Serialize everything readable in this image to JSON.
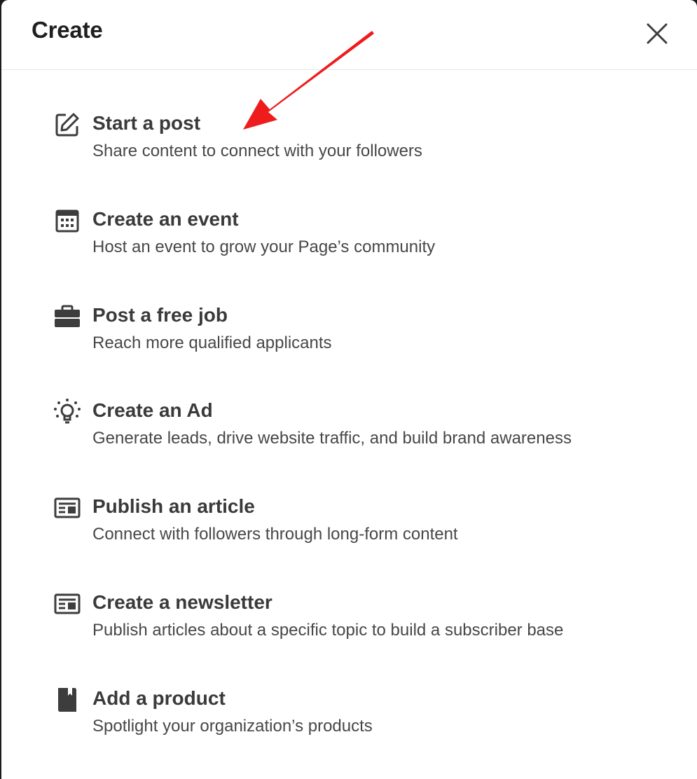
{
  "modal": {
    "title": "Create",
    "close_icon": "close-icon"
  },
  "items": [
    {
      "icon": "pencil-square-icon",
      "title": "Start a post",
      "description": "Share content to connect with your followers"
    },
    {
      "icon": "calendar-icon",
      "title": "Create an event",
      "description": "Host an event to grow your Page’s community"
    },
    {
      "icon": "briefcase-icon",
      "title": "Post a free job",
      "description": "Reach more qualified applicants"
    },
    {
      "icon": "lightbulb-icon",
      "title": "Create an Ad",
      "description": "Generate leads, drive website traffic, and build brand awareness"
    },
    {
      "icon": "article-icon",
      "title": "Publish an article",
      "description": "Connect with followers through long-form content"
    },
    {
      "icon": "newsletter-icon",
      "title": "Create a newsletter",
      "description": "Publish articles about a specific topic to build a subscriber base"
    },
    {
      "icon": "product-icon",
      "title": "Add a product",
      "description": "Spotlight your organization’s products"
    }
  ],
  "annotation": {
    "color": "#ee1c1c",
    "icon": "red-arrow-annotation"
  },
  "colors": {
    "title_text": "#1f1f1f",
    "item_title": "#3a3a3a",
    "item_desc": "#474747",
    "icon": "#3d3d3d"
  }
}
